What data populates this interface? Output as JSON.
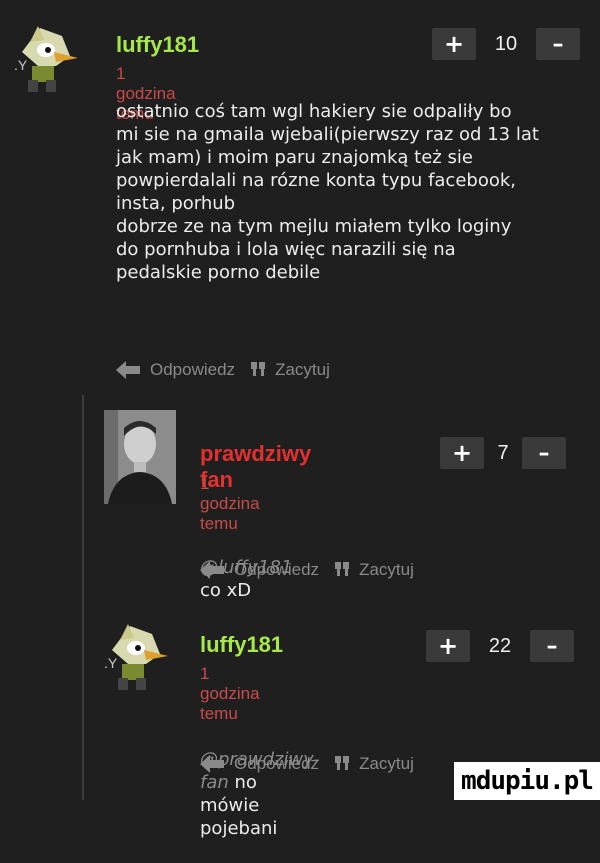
{
  "colors": {
    "background": "#1f1f1f",
    "author_green": "#a6e84a",
    "author_red": "#e2312f",
    "time_red": "#c74b47",
    "vote_bg": "#3a3a3a"
  },
  "actions": {
    "reply_label": "Odpowiedz",
    "quote_label": "Zacytuj",
    "reply_icon": "reply-arrow-icon",
    "quote_icon": "quote-icon"
  },
  "vote": {
    "plus": "+",
    "minus": "–"
  },
  "comments": [
    {
      "author": "luffy181",
      "time": "1 godzina temu",
      "votes": "10",
      "avatar_icon": "bird-character-avatar",
      "text": "ostatnio coś tam wgl hakiery sie odpaliły bo\nmi sie na gmaila wjebali(pierwszy raz od 13 lat\njak mam) i moim paru znajomką też sie\npowpierdalali na rózne konta typu facebook,\ninsta, porhub\ndobrze ze na tym mejlu miałem tylko loginy\ndo pornhuba i lola więc narazili się na\npedalskie porno debile"
    },
    {
      "author": "prawdziwy fan",
      "time": "1 godzina temu",
      "votes": "7",
      "avatar_icon": "man-portrait-avatar",
      "mention": "@luffy181",
      "text": " co xD"
    },
    {
      "author": "luffy181",
      "time": "1 godzina temu",
      "votes": "22",
      "avatar_icon": "bird-character-avatar",
      "mention": "@prawdziwy-fan",
      "text": " no mówie pojebani"
    }
  ],
  "watermark": "mdupiu.pl"
}
